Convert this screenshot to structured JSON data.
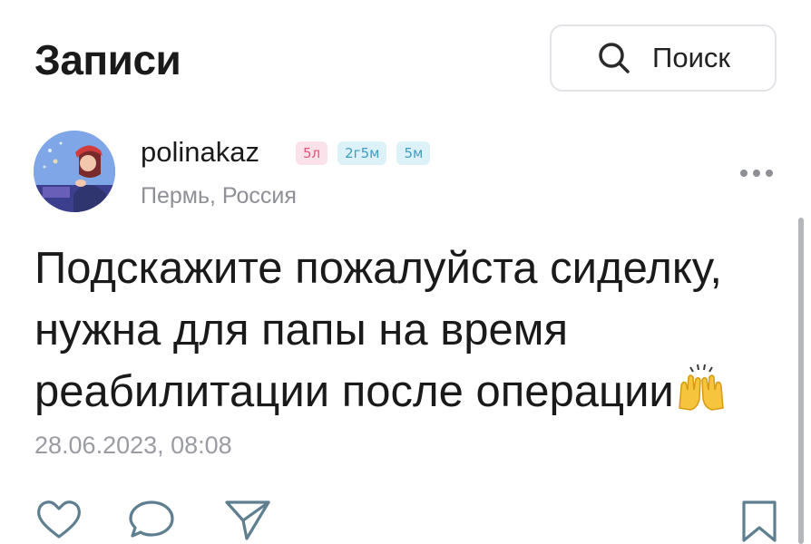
{
  "header": {
    "title": "Записи",
    "search_label": "Поиск"
  },
  "post": {
    "author": {
      "username": "polinakaz",
      "location": "Пермь, Россия",
      "badges": [
        {
          "label": "5л",
          "color": "#e0557f"
        },
        {
          "label": "2г5м",
          "color": "#3e9dc0"
        },
        {
          "label": "5м",
          "color": "#3e9dc0"
        }
      ]
    },
    "text_lines": [
      "Подскажите пожалуйста сиделку,",
      "нужна для папы на время",
      "реабилитации после операции"
    ],
    "text_emoji_icon": "raising-hands-icon",
    "timestamp": "28.06.2023, 08:08"
  },
  "actions": {
    "like_icon": "heart-icon",
    "comment_icon": "comment-icon",
    "share_icon": "share-icon",
    "bookmark_icon": "bookmark-icon"
  },
  "colors": {
    "text": "#1a1a1a",
    "muted": "#8e9096",
    "badge_pink": "#e0557f",
    "badge_blue": "#3e9dc0",
    "icon_stroke": "#5e7f8f"
  }
}
